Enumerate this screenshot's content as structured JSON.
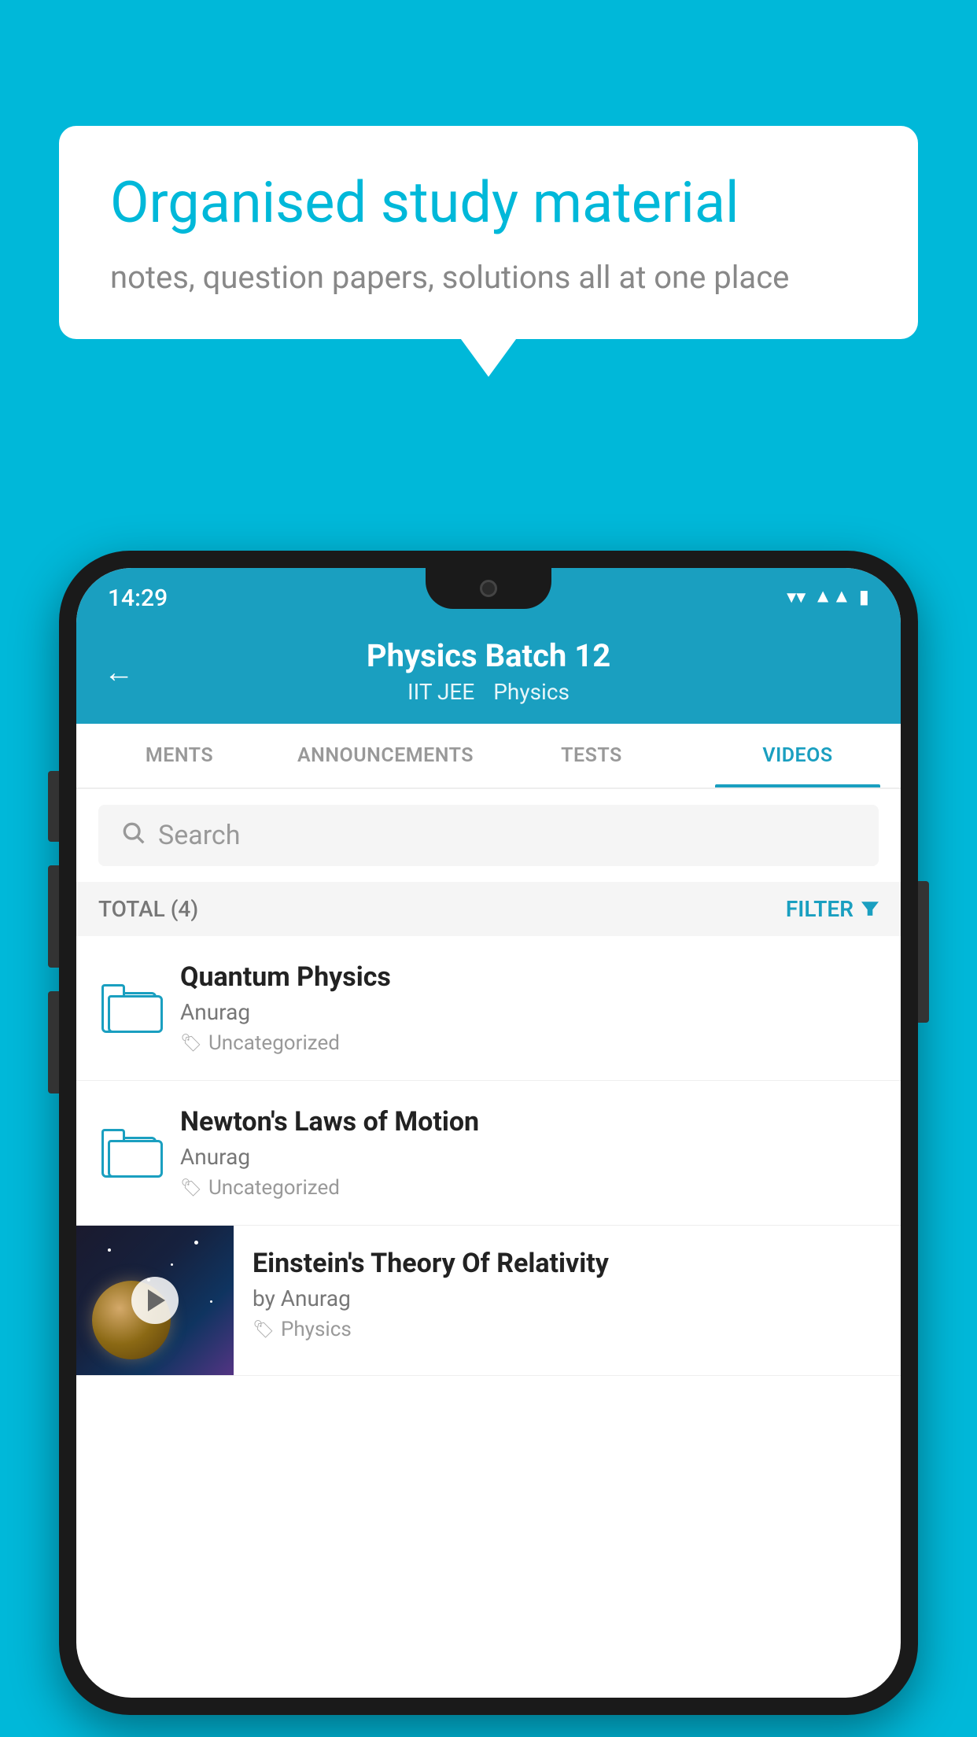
{
  "background_color": "#00b8d9",
  "speech_bubble": {
    "title": "Organised study material",
    "subtitle": "notes, question papers, solutions all at one place"
  },
  "phone": {
    "status_bar": {
      "time": "14:29",
      "icons": [
        "wifi",
        "signal",
        "battery"
      ]
    },
    "header": {
      "back_label": "←",
      "title": "Physics Batch 12",
      "tag1": "IIT JEE",
      "tag2": "Physics"
    },
    "tabs": [
      {
        "label": "MENTS",
        "active": false
      },
      {
        "label": "ANNOUNCEMENTS",
        "active": false
      },
      {
        "label": "TESTS",
        "active": false
      },
      {
        "label": "VIDEOS",
        "active": true
      }
    ],
    "search": {
      "placeholder": "Search"
    },
    "filter_row": {
      "total_label": "TOTAL (4)",
      "filter_label": "FILTER"
    },
    "items": [
      {
        "type": "folder",
        "title": "Quantum Physics",
        "author": "Anurag",
        "tag": "Uncategorized"
      },
      {
        "type": "folder",
        "title": "Newton's Laws of Motion",
        "author": "Anurag",
        "tag": "Uncategorized"
      },
      {
        "type": "thumb",
        "title": "Einstein's Theory Of Relativity",
        "author": "by Anurag",
        "tag": "Physics"
      }
    ]
  }
}
